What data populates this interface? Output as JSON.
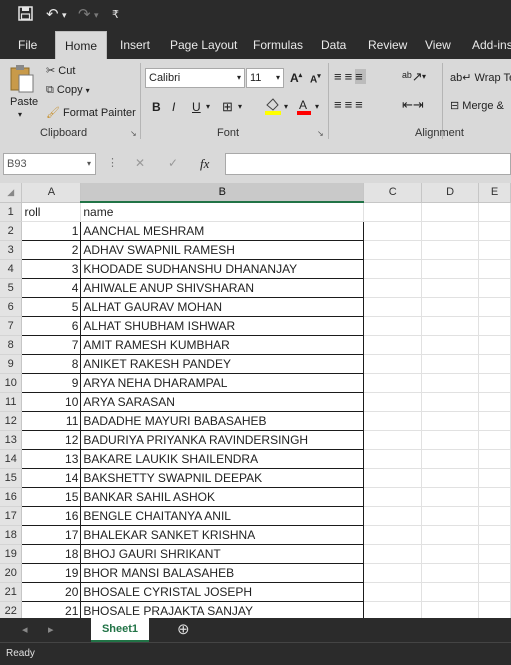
{
  "qat": {
    "save_icon": "save-icon",
    "undo_icon": "undo-icon",
    "redo_icon": "redo-icon",
    "customize_icon": "qat-customize-icon"
  },
  "tabs": [
    {
      "label": "File",
      "active": false
    },
    {
      "label": "Home",
      "active": true
    },
    {
      "label": "Insert",
      "active": false
    },
    {
      "label": "Page Layout",
      "active": false
    },
    {
      "label": "Formulas",
      "active": false
    },
    {
      "label": "Data",
      "active": false
    },
    {
      "label": "Review",
      "active": false
    },
    {
      "label": "View",
      "active": false
    },
    {
      "label": "Add-ins",
      "active": false
    }
  ],
  "ribbon": {
    "clipboard": {
      "paste": "Paste",
      "cut": "Cut",
      "copy": "Copy",
      "format_painter": "Format Painter",
      "group": "Clipboard"
    },
    "font": {
      "name": "Calibri",
      "size": "11",
      "grow": "A",
      "shrink": "A",
      "bold": "B",
      "italic": "I",
      "underline": "U",
      "group": "Font",
      "fill_color": "#ffff00",
      "font_color": "#ff0000"
    },
    "alignment": {
      "wrap": "Wrap Tex",
      "merge": "Merge &",
      "group": "Alignment"
    }
  },
  "formula_bar": {
    "name_box": "B93",
    "cancel": "✕",
    "enter": "✓",
    "fx": "fx",
    "value": ""
  },
  "grid": {
    "columns": [
      "A",
      "B",
      "C",
      "D",
      "E"
    ],
    "header": {
      "roll": "roll",
      "name": "name"
    },
    "rows": [
      {
        "roll": "1",
        "name": "AANCHAL MESHRAM"
      },
      {
        "roll": "2",
        "name": "ADHAV SWAPNIL RAMESH"
      },
      {
        "roll": "3",
        "name": "KHODADE SUDHANSHU DHANANJAY"
      },
      {
        "roll": "4",
        "name": "AHIWALE ANUP SHIVSHARAN"
      },
      {
        "roll": "5",
        "name": "ALHAT GAURAV MOHAN"
      },
      {
        "roll": "6",
        "name": "ALHAT SHUBHAM ISHWAR"
      },
      {
        "roll": "7",
        "name": "AMIT RAMESH KUMBHAR"
      },
      {
        "roll": "8",
        "name": "ANIKET RAKESH PANDEY"
      },
      {
        "roll": "9",
        "name": "ARYA NEHA DHARAMPAL"
      },
      {
        "roll": "10",
        "name": "ARYA SARASAN"
      },
      {
        "roll": "11",
        "name": "BADADHE MAYURI BABASAHEB"
      },
      {
        "roll": "12",
        "name": "BADURIYA PRIYANKA RAVINDERSINGH"
      },
      {
        "roll": "13",
        "name": "BAKARE LAUKIK SHAILENDRA"
      },
      {
        "roll": "14",
        "name": "BAKSHETTY SWAPNIL DEEPAK"
      },
      {
        "roll": "15",
        "name": "BANKAR SAHIL ASHOK"
      },
      {
        "roll": "16",
        "name": "BENGLE CHAITANYA ANIL"
      },
      {
        "roll": "17",
        "name": "BHALEKAR SANKET KRISHNA"
      },
      {
        "roll": "18",
        "name": "BHOJ GAURI SHRIKANT"
      },
      {
        "roll": "19",
        "name": "BHOR MANSI BALASAHEB"
      },
      {
        "roll": "20",
        "name": "BHOSALE CYRISTAL JOSEPH"
      },
      {
        "roll": "21",
        "name": "BHOSALE PRAJAKTA SANJAY"
      }
    ]
  },
  "sheets": [
    {
      "label": "Sheet1",
      "active": true
    }
  ],
  "add_sheet": "⊕",
  "status": "Ready"
}
